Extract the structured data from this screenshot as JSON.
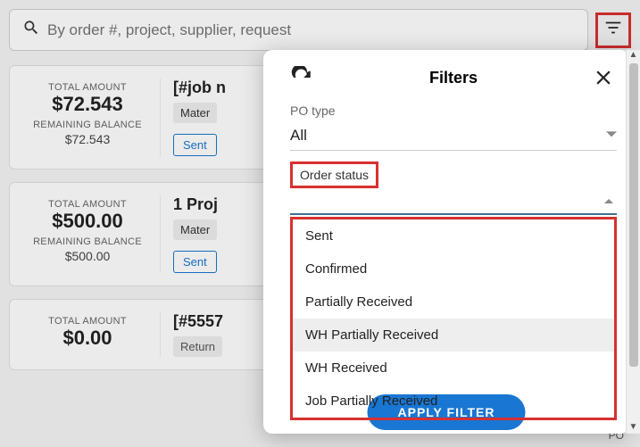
{
  "search": {
    "placeholder": "By order #, project, supplier, request"
  },
  "cards": [
    {
      "total_label": "TOTAL AMOUNT",
      "total": "$72.543",
      "remain_label": "REMAINING BALANCE",
      "remain": "$72.543",
      "title": "[#job n",
      "tag": "Mater",
      "status": "Sent"
    },
    {
      "total_label": "TOTAL AMOUNT",
      "total": "$500.00",
      "remain_label": "REMAINING BALANCE",
      "remain": "$500.00",
      "title": "1 Proj",
      "tag": "Mater",
      "status": "Sent"
    },
    {
      "total_label": "TOTAL AMOUNT",
      "total": "$0.00",
      "remain_label": "",
      "remain": "",
      "title": "[#5557",
      "tag": "Return",
      "status": ""
    }
  ],
  "panel": {
    "title": "Filters",
    "po_type_label": "PO type",
    "po_type_value": "All",
    "order_status_label": "Order status",
    "options": {
      "0": "Sent",
      "1": "Confirmed",
      "2": "Partially Received",
      "3": "WH Partially Received",
      "4": "WH Received",
      "5": "Job Partially Received"
    },
    "apply_label": "APPLY FILTER"
  },
  "fragment": "PO"
}
